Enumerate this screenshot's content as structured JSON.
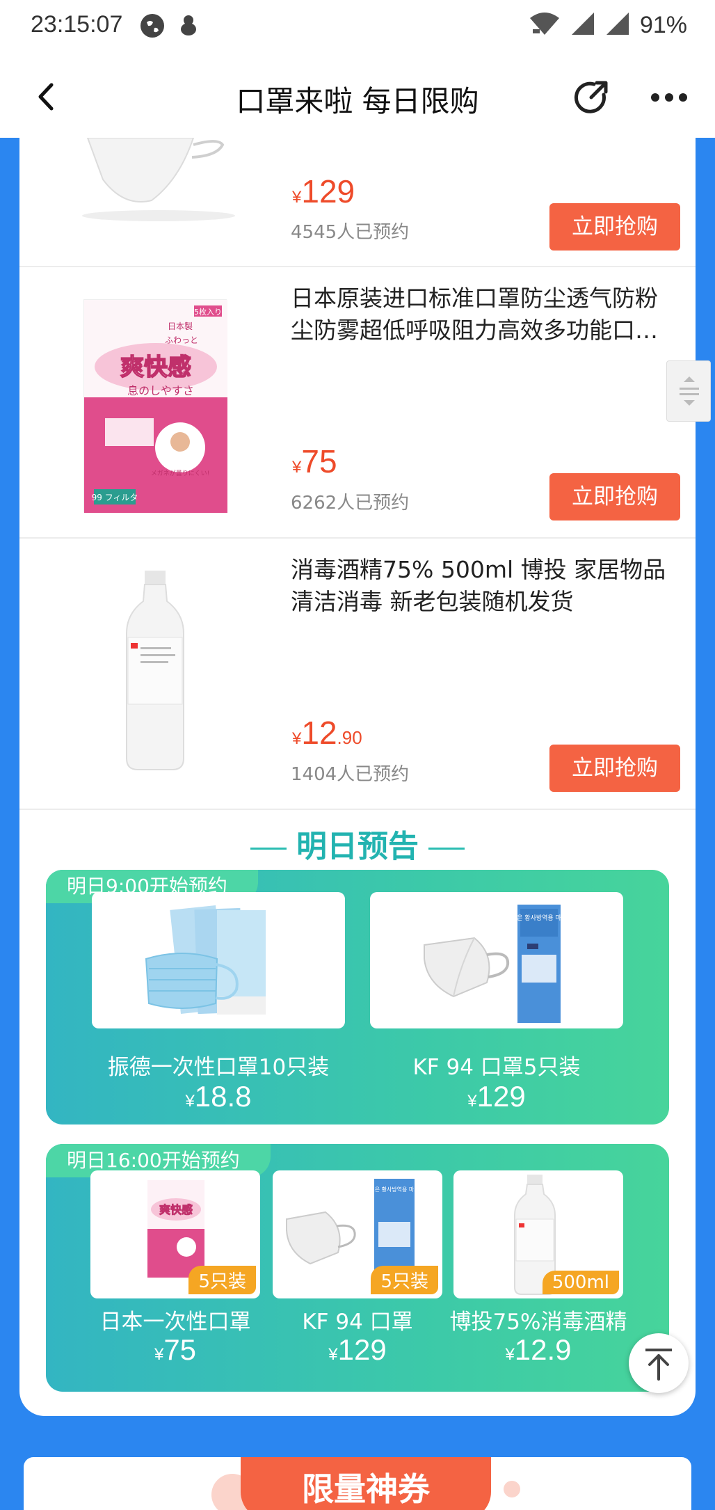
{
  "status_bar": {
    "time": "23:15:07",
    "battery": "91%"
  },
  "nav": {
    "title": "口罩来啦 每日限购"
  },
  "products": [
    {
      "title": "",
      "price_symbol": "¥",
      "price": "129",
      "price_decimal": "",
      "booked": "4545人已预约",
      "button": "立即抢购"
    },
    {
      "title": "日本原装进口标准口罩防尘透气防粉尘防雾超低呼吸阻力高效多功能口…",
      "price_symbol": "¥",
      "price": "75",
      "price_decimal": "",
      "booked": "6262人已预约",
      "button": "立即抢购",
      "package": {
        "top_label": "5枚入り",
        "brand": "日本製",
        "small_text": "ふわっと",
        "main": "爽快感",
        "sub": "息のしやすさ",
        "callout": "メガネが曇りにくい!",
        "footer": "99 フィルタ"
      }
    },
    {
      "title": "消毒酒精75% 500ml 博投 家居物品 清洁消毒 新老包装随机发货",
      "price_symbol": "¥",
      "price": "12",
      "price_decimal": ".90",
      "booked": "1404人已预约",
      "button": "立即抢购"
    }
  ],
  "preview": {
    "title": "明日预告",
    "group1": {
      "tag": "明日9:00开始预约",
      "items": [
        {
          "label": "振德一次性口罩10只装",
          "price_symbol": "¥",
          "price": "18.8"
        },
        {
          "label": "KF 94 口罩5只装",
          "price_symbol": "¥",
          "price": "129",
          "box_text": "더조은 황사방역용 마스크"
        }
      ]
    },
    "group2": {
      "tag": "明日16:00开始预约",
      "items": [
        {
          "label": "日本一次性口罩",
          "price_symbol": "¥",
          "price": "75",
          "badge": "5只装",
          "box_text": "爽快感"
        },
        {
          "label": "KF 94 口罩",
          "price_symbol": "¥",
          "price": "129",
          "badge": "5只装",
          "box_text": "더조은 황사방역용 마스크"
        },
        {
          "label": "博投75%消毒酒精",
          "price_symbol": "¥",
          "price": "12.9",
          "badge": "500ml"
        }
      ]
    }
  },
  "coupon": {
    "title": "限量神券"
  },
  "colors": {
    "accent": "#f46343",
    "price": "#ee4b2a",
    "page_bg": "#2b86f0",
    "teal": "#3cc9a9"
  }
}
